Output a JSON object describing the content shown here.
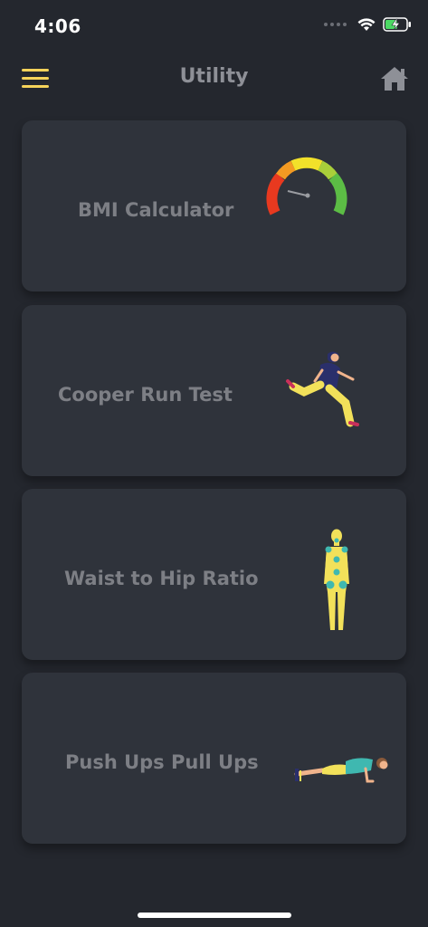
{
  "status_bar": {
    "time": "4:06"
  },
  "header": {
    "title": "Utility"
  },
  "cards": [
    {
      "label": "BMI Calculator",
      "icon": "speedometer-gauge-icon"
    },
    {
      "label": "Cooper Run Test",
      "icon": "running-person-icon"
    },
    {
      "label": "Waist to Hip Ratio",
      "icon": "body-figure-icon"
    },
    {
      "label": "Push Ups Pull Ups",
      "icon": "pushup-person-icon"
    }
  ],
  "colors": {
    "background": "#24272e",
    "card": "#2f333b",
    "accent": "#f5d35a",
    "label": "#7d7f85"
  }
}
